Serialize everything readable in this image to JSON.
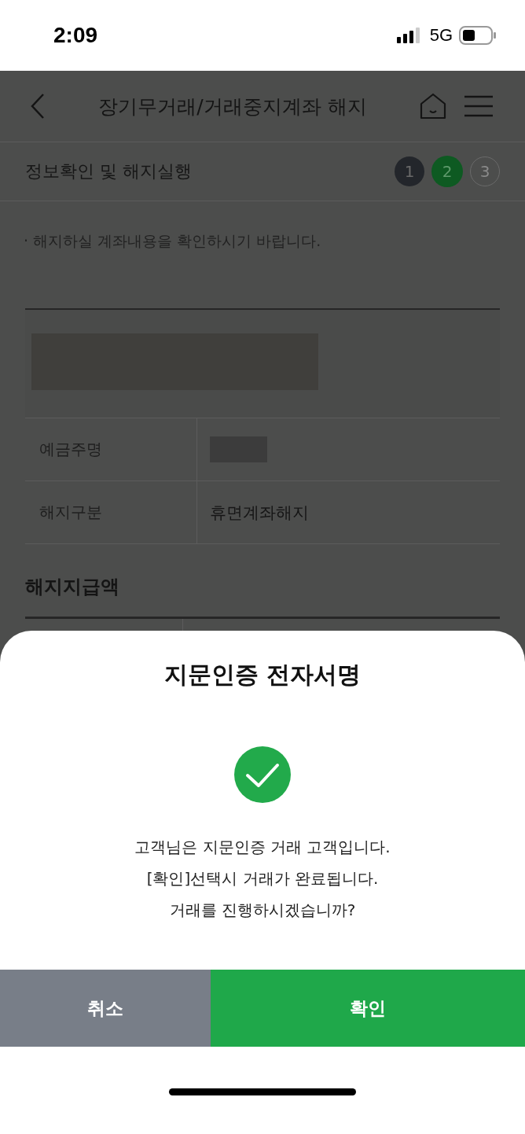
{
  "status_bar": {
    "time": "2:09",
    "network": "5G"
  },
  "header": {
    "title": "장기무거래/거래중지계좌 해지"
  },
  "step_bar": {
    "title": "정보확인 및 해지실행",
    "steps": [
      {
        "label": "1",
        "kind": "done",
        "selected": false
      },
      {
        "label": "2",
        "kind": "current",
        "selected": true
      },
      {
        "label": "3",
        "kind": "todo",
        "selected": false
      }
    ]
  },
  "notice": "· 해지하실 계좌내용을 확인하시기 바랍니다.",
  "account_table": {
    "rows": [
      {
        "label": "예금주명",
        "kind": "redacted"
      },
      {
        "label": "해지구분",
        "kind": "text",
        "value": "휴면계좌해지"
      }
    ]
  },
  "payout_section": {
    "title": "해지지급액"
  },
  "dialog": {
    "title": "지문인증 전자서명",
    "message_lines": [
      "고객님은 지문인증 거래 고객입니다.",
      "[확인]선택시 거래가 완료됩니다.",
      "거래를 진행하시겠습니까?"
    ],
    "buttons": [
      {
        "label": "취소",
        "kind": "cancel"
      },
      {
        "label": "확인",
        "kind": "confirm"
      }
    ]
  }
}
